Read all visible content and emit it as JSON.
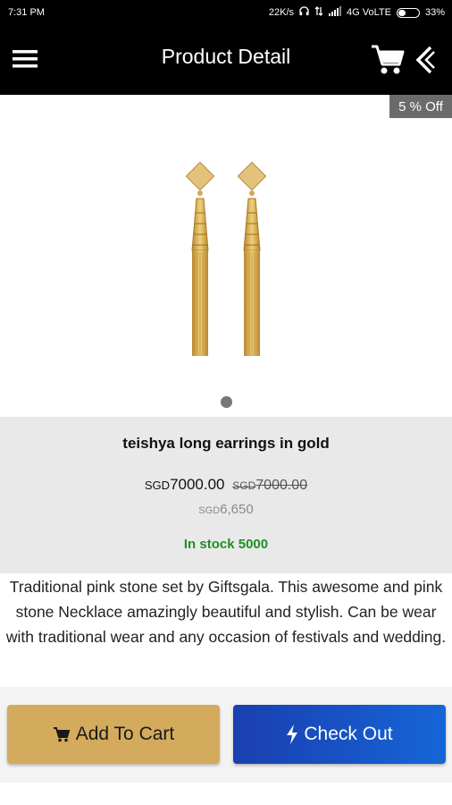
{
  "status_bar": {
    "time": "7:31 PM",
    "network": "22K/s",
    "carrier": "4G VoLTE",
    "battery": "33%",
    "battery_level": 0.33
  },
  "header": {
    "title": "Product Detail",
    "icons": [
      "menu-icon",
      "cart-icon",
      "back-icon"
    ]
  },
  "discount_badge": "5 % Off",
  "product": {
    "name": "teishya long earrings in gold",
    "price_currency": "SGD",
    "price": "7000.00",
    "original_currency": "SGD",
    "original_price": "7000.00",
    "offer_currency": "SGD",
    "offer_price": "6,650",
    "stock": "In stock 5000",
    "description": "Traditional pink stone set by Giftsgala. This awesome and pink stone Necklace amazingly beautiful and stylish. Can be wear with traditional wear and any occasion of festivals and wedding."
  },
  "actions": {
    "add_to_cart": "Add To Cart",
    "check_out": "Check Out"
  },
  "colors": {
    "header_bg": "#000000",
    "gold": "#d4ab5c",
    "checkout_blue": "#1a4fc4",
    "stock_green": "#1f8f24"
  }
}
